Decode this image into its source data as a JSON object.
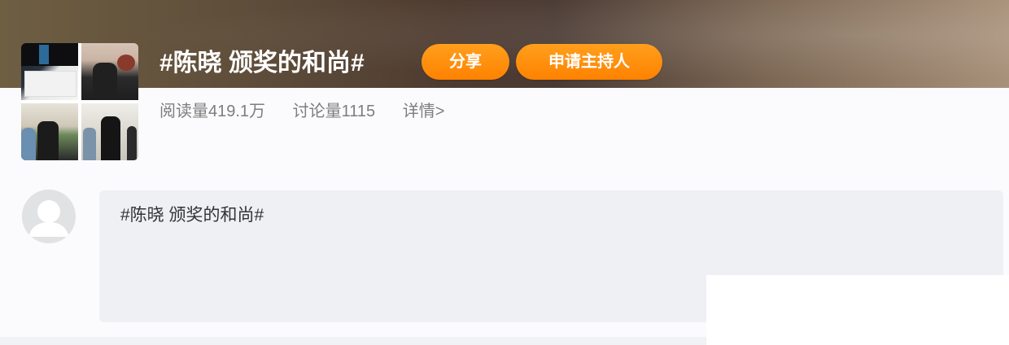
{
  "topic": {
    "title": "#陈晓 颁奖的和尚#",
    "share_label": "分享",
    "host_label": "申请主持人"
  },
  "stats": {
    "read": "阅读量419.1万",
    "discussion": "讨论量1115",
    "details": "详情>"
  },
  "compose": {
    "text": "#陈晓 颁奖的和尚#"
  },
  "colors": {
    "button_orange": "#ff8200",
    "stats_gray": "#7d7d7d",
    "compose_bg": "#eef0f4"
  },
  "icons": {
    "avatar": "default-user-avatar-icon"
  }
}
